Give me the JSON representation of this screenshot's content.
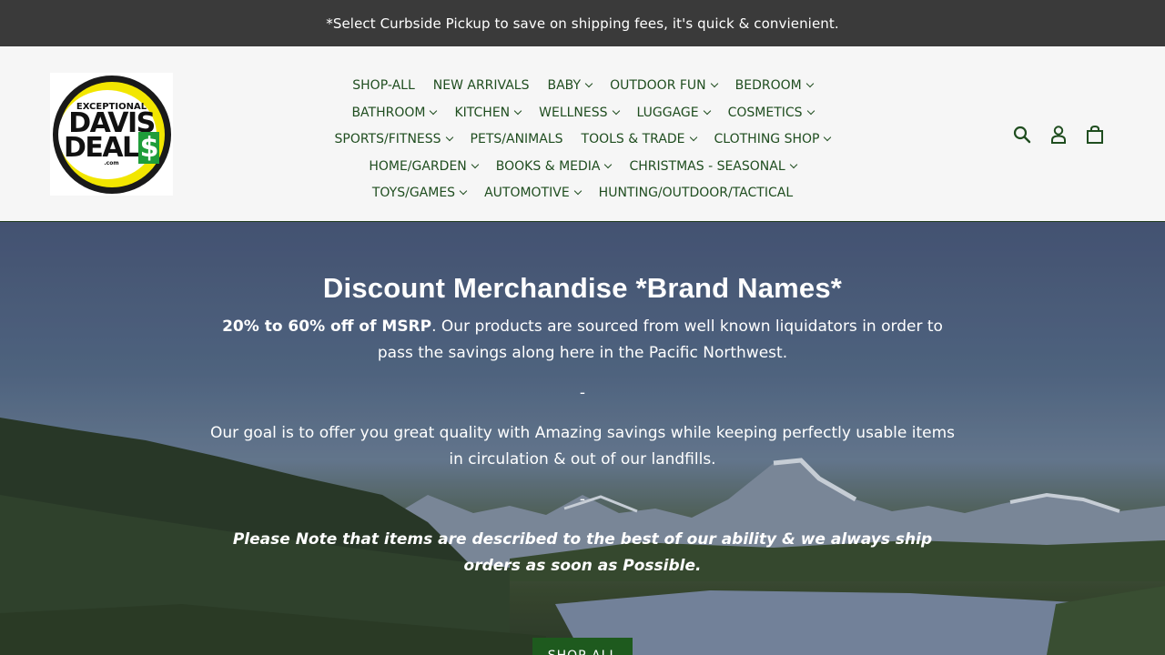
{
  "announcement": "*Select Curbside Pickup to save on shipping fees, it's quick & convienient.",
  "logo": {
    "line1": "EXCEPTIONAL",
    "line2": "DAVIS",
    "line3_main": "DEAL",
    "line3_dollar": "$",
    "line4": ".com"
  },
  "nav": {
    "items": [
      {
        "label": "SHOP-ALL",
        "dropdown": false
      },
      {
        "label": "NEW ARRIVALS",
        "dropdown": false
      },
      {
        "label": "BABY",
        "dropdown": true
      },
      {
        "label": "OUTDOOR FUN",
        "dropdown": true
      },
      {
        "label": "BEDROOM",
        "dropdown": true
      },
      {
        "label": "BATHROOM",
        "dropdown": true
      },
      {
        "label": "KITCHEN",
        "dropdown": true
      },
      {
        "label": "WELLNESS",
        "dropdown": true
      },
      {
        "label": "LUGGAGE",
        "dropdown": true
      },
      {
        "label": "COSMETICS",
        "dropdown": true
      },
      {
        "label": "SPORTS/FITNESS",
        "dropdown": true
      },
      {
        "label": "PETS/ANIMALS",
        "dropdown": false
      },
      {
        "label": "TOOLS & TRADE",
        "dropdown": true
      },
      {
        "label": "CLOTHING SHOP",
        "dropdown": true
      },
      {
        "label": "HOME/GARDEN",
        "dropdown": true
      },
      {
        "label": "BOOKS & MEDIA",
        "dropdown": true
      },
      {
        "label": "CHRISTMAS - SEASONAL",
        "dropdown": true
      },
      {
        "label": "TOYS/GAMES",
        "dropdown": true
      },
      {
        "label": "AUTOMOTIVE",
        "dropdown": true
      },
      {
        "label": "HUNTING/OUTDOOR/TACTICAL",
        "dropdown": false
      }
    ]
  },
  "header_icons": [
    "search-icon",
    "account-icon",
    "cart-icon"
  ],
  "colors": {
    "accent": "#1e5a1e",
    "nav_text": "#1f4d1f",
    "announce_bg": "#3a3a3a"
  },
  "hero": {
    "title": "Discount Merchandise *Brand Names*",
    "p1_bold": "20% to 60% off of MSRP",
    "p1_rest": ". Our products are sourced from well known liquidators in order to pass the savings along here in the Pacific Northwest.",
    "dash1": "-",
    "p2": "Our goal is to offer you great quality with Amazing savings while keeping perfectly usable items in circulation & out of our landfills.",
    "dash2": "-",
    "note": "Please Note that items are described to the best of our ability & we always ship orders as soon as Possible.",
    "button": "SHOP ALL"
  }
}
